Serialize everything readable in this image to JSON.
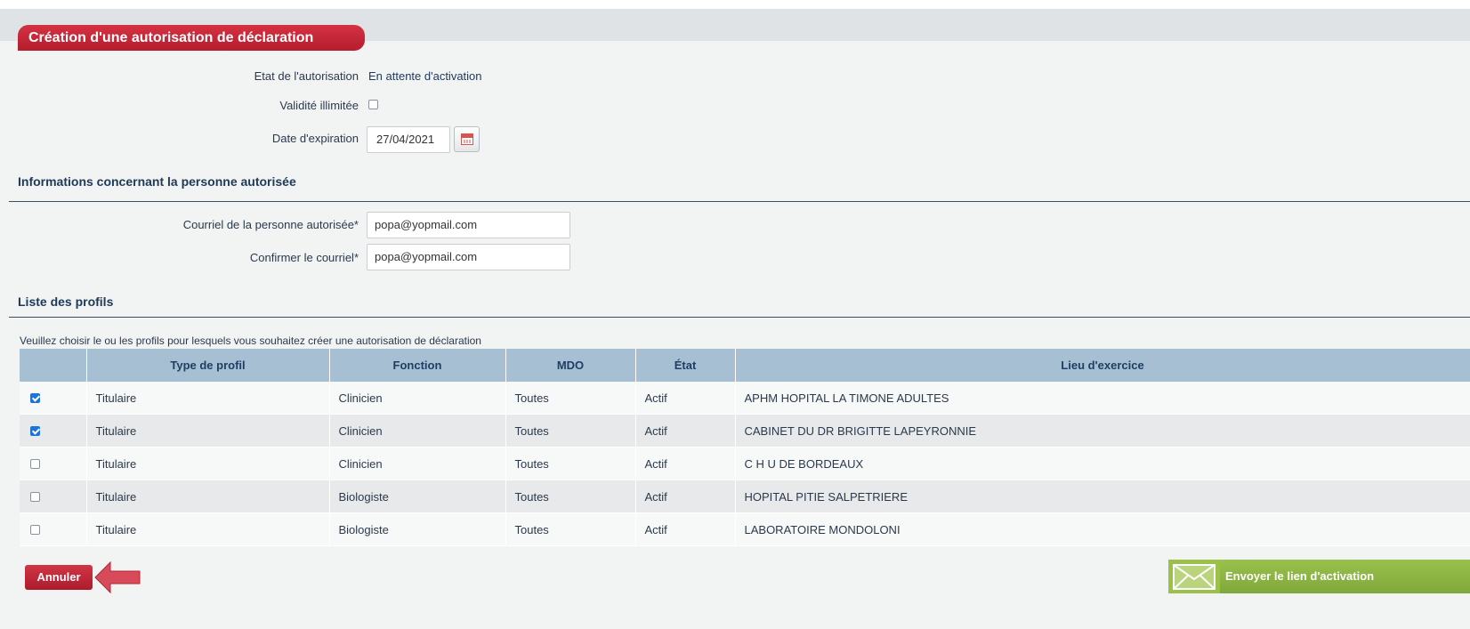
{
  "header": {
    "title": "Création d'une autorisation de déclaration"
  },
  "authorization": {
    "state_label": "Etat de l'autorisation",
    "state_value": "En attente d'activation",
    "unlimited_label": "Validité illimitée",
    "unlimited_checked": false,
    "expiration_label": "Date d'expiration",
    "expiration_value": "27/04/2021"
  },
  "person_section": {
    "title": "Informations concernant la personne autorisée",
    "email_label": "Courriel de la personne autorisée*",
    "email_value": "popa@yopmail.com",
    "confirm_label": "Confirmer le courriel*",
    "confirm_value": "popa@yopmail.com"
  },
  "profiles_section": {
    "title": "Liste des profils",
    "hint": "Veuillez choisir le ou les profils pour lesquels vous souhaitez créer une autorisation de déclaration",
    "columns": [
      "",
      "Type de profil",
      "Fonction",
      "MDO",
      "État",
      "Lieu d'exercice"
    ],
    "rows": [
      {
        "checked": true,
        "type": "Titulaire",
        "fonction": "Clinicien",
        "mdo": "Toutes",
        "etat": "Actif",
        "lieu": "APHM HOPITAL LA TIMONE ADULTES"
      },
      {
        "checked": true,
        "type": "Titulaire",
        "fonction": "Clinicien",
        "mdo": "Toutes",
        "etat": "Actif",
        "lieu": "CABINET DU DR BRIGITTE LAPEYRONNIE"
      },
      {
        "checked": false,
        "type": "Titulaire",
        "fonction": "Clinicien",
        "mdo": "Toutes",
        "etat": "Actif",
        "lieu": "C H U DE BORDEAUX"
      },
      {
        "checked": false,
        "type": "Titulaire",
        "fonction": "Biologiste",
        "mdo": "Toutes",
        "etat": "Actif",
        "lieu": "HOPITAL PITIE SALPETRIERE"
      },
      {
        "checked": false,
        "type": "Titulaire",
        "fonction": "Biologiste",
        "mdo": "Toutes",
        "etat": "Actif",
        "lieu": "LABORATOIRE MONDOLONI"
      }
    ]
  },
  "actions": {
    "cancel_label": "Annuler",
    "send_label": "Envoyer le lien d'activation"
  },
  "colors": {
    "title_red": "#c62a3a",
    "header_blue": "#a6bfd3",
    "send_green": "#8fb845"
  },
  "icons": {
    "calendar": "calendar-icon",
    "arrow": "left-arrow-icon",
    "envelope": "envelope-icon"
  }
}
